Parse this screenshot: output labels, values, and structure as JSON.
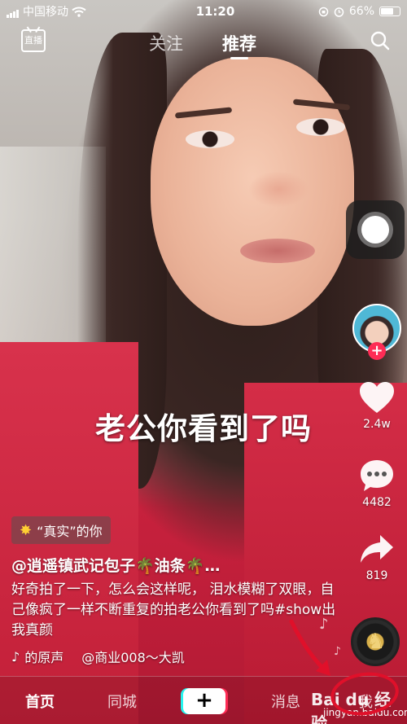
{
  "status_bar": {
    "carrier": "中国移动",
    "time": "11:20",
    "battery": "66%"
  },
  "top_nav": {
    "live_label": "直播",
    "tabs": [
      {
        "label": "关注"
      },
      {
        "label": "推荐"
      }
    ]
  },
  "video": {
    "caption": "老公你看到了吗"
  },
  "sidebar": {
    "like_count": "2.4w",
    "comment_count": "4482",
    "share_count": "819"
  },
  "info": {
    "tag": "“真实”的你",
    "author": "@逍遥镇武记包子🌴油条🌴…",
    "description": "好奇拍了一下，怎么会这样呢， 泪水模糊了双眼，自己像疯了一样不断重复的拍老公你看到了吗#show出我真颜",
    "music_left": "的原声",
    "music_right": "@商业008～大凯"
  },
  "bottom_bar": {
    "home": "首页",
    "city": "同城",
    "create": "+",
    "messages": "消息",
    "me": "我"
  },
  "watermark": {
    "brand": "Bai du 经验",
    "url": "jingyan.baidu.com"
  },
  "colors": {
    "accent_red": "#fe2c55",
    "accent_cyan": "#25f4ee",
    "annotation_red": "#e0102a"
  }
}
